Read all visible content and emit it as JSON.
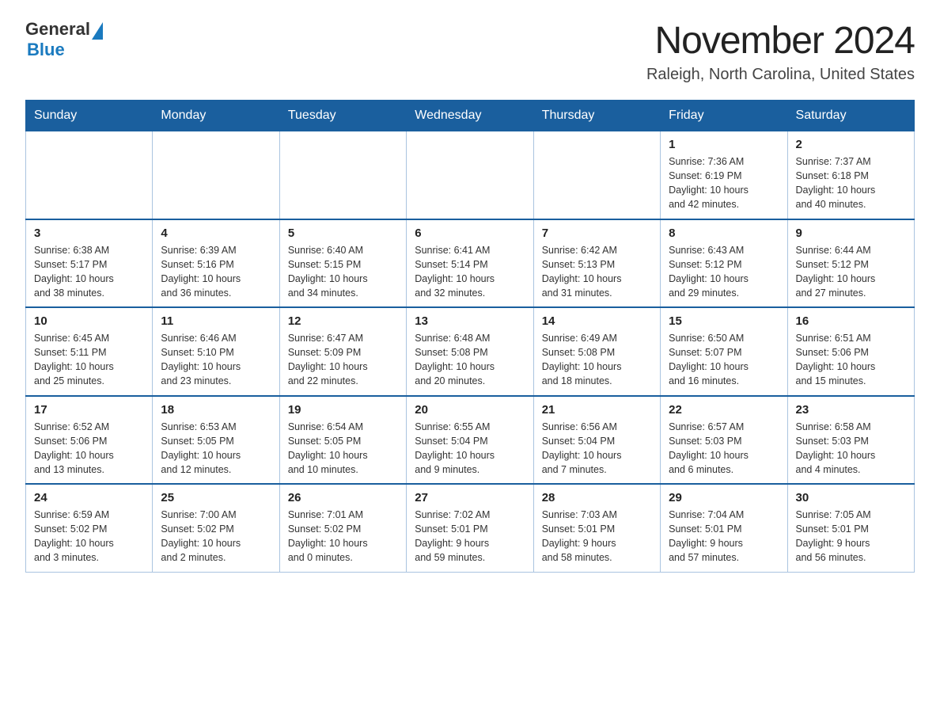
{
  "header": {
    "logo_general": "General",
    "logo_blue": "Blue",
    "month_title": "November 2024",
    "subtitle": "Raleigh, North Carolina, United States"
  },
  "weekdays": [
    "Sunday",
    "Monday",
    "Tuesday",
    "Wednesday",
    "Thursday",
    "Friday",
    "Saturday"
  ],
  "weeks": [
    [
      {
        "day": "",
        "info": ""
      },
      {
        "day": "",
        "info": ""
      },
      {
        "day": "",
        "info": ""
      },
      {
        "day": "",
        "info": ""
      },
      {
        "day": "",
        "info": ""
      },
      {
        "day": "1",
        "info": "Sunrise: 7:36 AM\nSunset: 6:19 PM\nDaylight: 10 hours\nand 42 minutes."
      },
      {
        "day": "2",
        "info": "Sunrise: 7:37 AM\nSunset: 6:18 PM\nDaylight: 10 hours\nand 40 minutes."
      }
    ],
    [
      {
        "day": "3",
        "info": "Sunrise: 6:38 AM\nSunset: 5:17 PM\nDaylight: 10 hours\nand 38 minutes."
      },
      {
        "day": "4",
        "info": "Sunrise: 6:39 AM\nSunset: 5:16 PM\nDaylight: 10 hours\nand 36 minutes."
      },
      {
        "day": "5",
        "info": "Sunrise: 6:40 AM\nSunset: 5:15 PM\nDaylight: 10 hours\nand 34 minutes."
      },
      {
        "day": "6",
        "info": "Sunrise: 6:41 AM\nSunset: 5:14 PM\nDaylight: 10 hours\nand 32 minutes."
      },
      {
        "day": "7",
        "info": "Sunrise: 6:42 AM\nSunset: 5:13 PM\nDaylight: 10 hours\nand 31 minutes."
      },
      {
        "day": "8",
        "info": "Sunrise: 6:43 AM\nSunset: 5:12 PM\nDaylight: 10 hours\nand 29 minutes."
      },
      {
        "day": "9",
        "info": "Sunrise: 6:44 AM\nSunset: 5:12 PM\nDaylight: 10 hours\nand 27 minutes."
      }
    ],
    [
      {
        "day": "10",
        "info": "Sunrise: 6:45 AM\nSunset: 5:11 PM\nDaylight: 10 hours\nand 25 minutes."
      },
      {
        "day": "11",
        "info": "Sunrise: 6:46 AM\nSunset: 5:10 PM\nDaylight: 10 hours\nand 23 minutes."
      },
      {
        "day": "12",
        "info": "Sunrise: 6:47 AM\nSunset: 5:09 PM\nDaylight: 10 hours\nand 22 minutes."
      },
      {
        "day": "13",
        "info": "Sunrise: 6:48 AM\nSunset: 5:08 PM\nDaylight: 10 hours\nand 20 minutes."
      },
      {
        "day": "14",
        "info": "Sunrise: 6:49 AM\nSunset: 5:08 PM\nDaylight: 10 hours\nand 18 minutes."
      },
      {
        "day": "15",
        "info": "Sunrise: 6:50 AM\nSunset: 5:07 PM\nDaylight: 10 hours\nand 16 minutes."
      },
      {
        "day": "16",
        "info": "Sunrise: 6:51 AM\nSunset: 5:06 PM\nDaylight: 10 hours\nand 15 minutes."
      }
    ],
    [
      {
        "day": "17",
        "info": "Sunrise: 6:52 AM\nSunset: 5:06 PM\nDaylight: 10 hours\nand 13 minutes."
      },
      {
        "day": "18",
        "info": "Sunrise: 6:53 AM\nSunset: 5:05 PM\nDaylight: 10 hours\nand 12 minutes."
      },
      {
        "day": "19",
        "info": "Sunrise: 6:54 AM\nSunset: 5:05 PM\nDaylight: 10 hours\nand 10 minutes."
      },
      {
        "day": "20",
        "info": "Sunrise: 6:55 AM\nSunset: 5:04 PM\nDaylight: 10 hours\nand 9 minutes."
      },
      {
        "day": "21",
        "info": "Sunrise: 6:56 AM\nSunset: 5:04 PM\nDaylight: 10 hours\nand 7 minutes."
      },
      {
        "day": "22",
        "info": "Sunrise: 6:57 AM\nSunset: 5:03 PM\nDaylight: 10 hours\nand 6 minutes."
      },
      {
        "day": "23",
        "info": "Sunrise: 6:58 AM\nSunset: 5:03 PM\nDaylight: 10 hours\nand 4 minutes."
      }
    ],
    [
      {
        "day": "24",
        "info": "Sunrise: 6:59 AM\nSunset: 5:02 PM\nDaylight: 10 hours\nand 3 minutes."
      },
      {
        "day": "25",
        "info": "Sunrise: 7:00 AM\nSunset: 5:02 PM\nDaylight: 10 hours\nand 2 minutes."
      },
      {
        "day": "26",
        "info": "Sunrise: 7:01 AM\nSunset: 5:02 PM\nDaylight: 10 hours\nand 0 minutes."
      },
      {
        "day": "27",
        "info": "Sunrise: 7:02 AM\nSunset: 5:01 PM\nDaylight: 9 hours\nand 59 minutes."
      },
      {
        "day": "28",
        "info": "Sunrise: 7:03 AM\nSunset: 5:01 PM\nDaylight: 9 hours\nand 58 minutes."
      },
      {
        "day": "29",
        "info": "Sunrise: 7:04 AM\nSunset: 5:01 PM\nDaylight: 9 hours\nand 57 minutes."
      },
      {
        "day": "30",
        "info": "Sunrise: 7:05 AM\nSunset: 5:01 PM\nDaylight: 9 hours\nand 56 minutes."
      }
    ]
  ]
}
